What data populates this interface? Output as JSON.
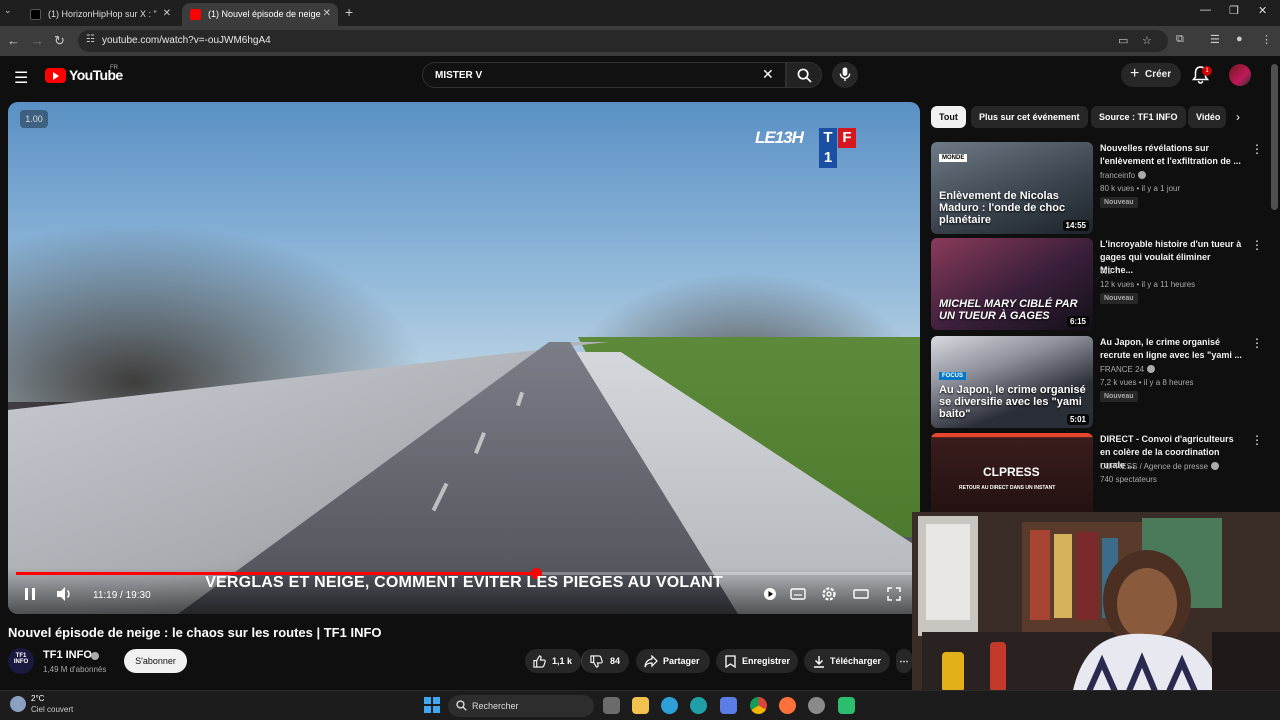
{
  "browser": {
    "tabs": [
      {
        "title": "(1) HorizonHipHop sur X : \"",
        "active": false
      },
      {
        "title": "(1) Nouvel épisode de neige",
        "active": true
      }
    ],
    "url": "youtube.com/watch?v=-ouJWM6hgA4"
  },
  "header": {
    "logo_text": "YouTube",
    "country": "FR",
    "search_value": "MISTER V",
    "create_label": "Créer",
    "notifications": "1"
  },
  "player": {
    "speed": "1.00",
    "logo_show": "LE13H",
    "logo_letters": [
      "T",
      "F",
      "1"
    ],
    "caption": "VERGLAS ET NEIGE, COMMENT EVITER LES PIEGES AU VOLANT",
    "current_time": "11:19",
    "duration": "19:30",
    "time_display": "11:19 / 19:30",
    "progress": 0.58
  },
  "video": {
    "title": "Nouvel épisode de neige : le chaos sur les routes | TF1 INFO",
    "channel_name": "TF1 INFO",
    "channel_avatar_text": "TF1 INFO",
    "subscribers": "1,49 M d'abonnés",
    "subscribe_label": "S'abonner",
    "likes": "1,1 k",
    "dislikes": "84",
    "share_label": "Partager",
    "save_label": "Enregistrer",
    "download_label": "Télécharger"
  },
  "chips": [
    "Tout",
    "Plus sur cet événement",
    "Source : TF1 INFO",
    "Vidéo"
  ],
  "recommendations": [
    {
      "title": "Nouvelles révélations sur l'enlèvement et l'exfiltration de ...",
      "channel": "franceinfo",
      "meta": "80 k vues • il y a 1 jour",
      "badge": "Nouveau",
      "duration": "14:55",
      "thumb_text": "Enlèvement de Nicolas Maduro : l'onde de choc planétaire",
      "thumb_tag": "MONDE"
    },
    {
      "title": "L'incroyable histoire d'un tueur à gages qui voulait éliminer Miche...",
      "channel": "W9",
      "meta": "12 k vues • il y a 11 heures",
      "badge": "Nouveau",
      "duration": "6:15",
      "thumb_text": "MICHEL MARY CIBLÉ PAR UN TUEUR À GAGES",
      "thumb_tag": ""
    },
    {
      "title": "Au Japon, le crime organisé recrute en ligne avec les \"yami ...",
      "channel": "FRANCE 24",
      "meta": "7,2 k vues • il y a 8 heures",
      "badge": "Nouveau",
      "duration": "5:01",
      "thumb_text": "Au Japon, le crime organisé se diversifie avec les \"yami baito\"",
      "thumb_tag": "FOCUS"
    },
    {
      "title": "DIRECT - Convoi d'agriculteurs en colère de la coordination rurale ...",
      "channel": "CLPRESS / Agence de presse",
      "meta": "740 spectateurs",
      "badge": "",
      "duration": "",
      "thumb_text": "CLPRESS",
      "thumb_tag": "RETOUR AU DIRECT DANS UN INSTANT"
    }
  ],
  "taskbar": {
    "temperature": "2°C",
    "weather": "Ciel couvert",
    "search_label": "Rechercher"
  },
  "colors": {
    "accent": "#ff0000",
    "background": "#0f0f0f",
    "tf1_blue": "#1b4fa3",
    "tf1_red": "#d7171f"
  }
}
